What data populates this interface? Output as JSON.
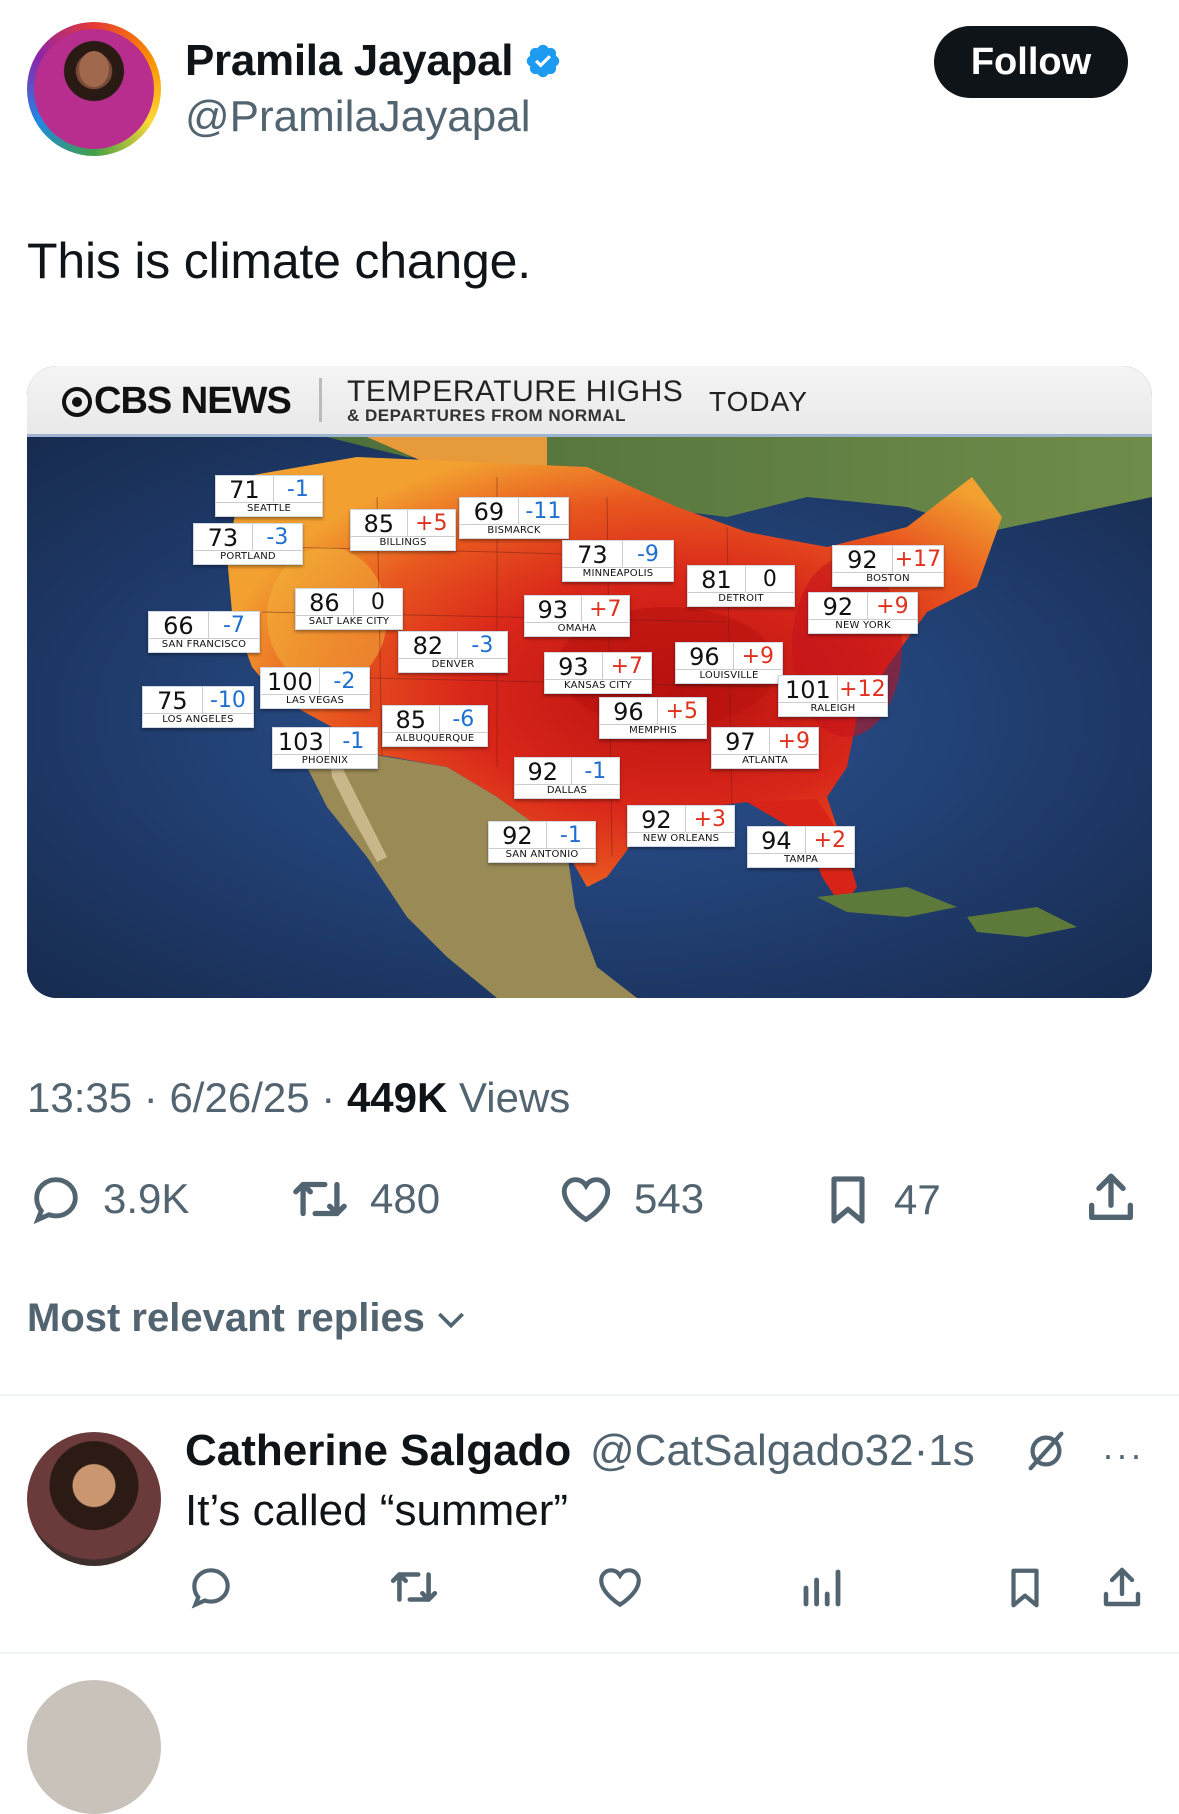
{
  "post": {
    "author_name": "Pramila Jayapal",
    "author_handle": "@PramilaJayapal",
    "follow_label": "Follow",
    "text": "This is climate change.",
    "time": "13:35",
    "date": "6/26/25",
    "dot": "·",
    "views_count": "449K",
    "views_label": "Views",
    "stats": {
      "replies": "3.9K",
      "reposts": "480",
      "likes": "543",
      "bookmarks": "47"
    }
  },
  "media": {
    "brand": "CBS NEWS",
    "title": "TEMPERATURE HIGHS",
    "subtitle": "& DEPARTURES FROM NORMAL",
    "period": "TODAY",
    "cities": [
      {
        "name": "SEATTLE",
        "temp": "71",
        "dep": "-1",
        "sign": "neg"
      },
      {
        "name": "PORTLAND",
        "temp": "73",
        "dep": "-3",
        "sign": "neg"
      },
      {
        "name": "BILLINGS",
        "temp": "85",
        "dep": "+5",
        "sign": "pos"
      },
      {
        "name": "BISMARCK",
        "temp": "69",
        "dep": "-11",
        "sign": "neg"
      },
      {
        "name": "MINNEAPOLIS",
        "temp": "73",
        "dep": "-9",
        "sign": "neg"
      },
      {
        "name": "DETROIT",
        "temp": "81",
        "dep": "0",
        "sign": "zero"
      },
      {
        "name": "BOSTON",
        "temp": "92",
        "dep": "+17",
        "sign": "pos"
      },
      {
        "name": "NEW YORK",
        "temp": "92",
        "dep": "+9",
        "sign": "pos"
      },
      {
        "name": "SALT LAKE CITY",
        "temp": "86",
        "dep": "0",
        "sign": "zero"
      },
      {
        "name": "SAN FRANCISCO",
        "temp": "66",
        "dep": "-7",
        "sign": "neg"
      },
      {
        "name": "OMAHA",
        "temp": "93",
        "dep": "+7",
        "sign": "pos"
      },
      {
        "name": "DENVER",
        "temp": "82",
        "dep": "-3",
        "sign": "neg"
      },
      {
        "name": "KANSAS CITY",
        "temp": "93",
        "dep": "+7",
        "sign": "pos"
      },
      {
        "name": "LOUISVILLE",
        "temp": "96",
        "dep": "+9",
        "sign": "pos"
      },
      {
        "name": "LAS VEGAS",
        "temp": "100",
        "dep": "-2",
        "sign": "neg"
      },
      {
        "name": "LOS ANGELES",
        "temp": "75",
        "dep": "-10",
        "sign": "neg"
      },
      {
        "name": "RALEIGH",
        "temp": "101",
        "dep": "+12",
        "sign": "pos"
      },
      {
        "name": "ALBUQUERQUE",
        "temp": "85",
        "dep": "-6",
        "sign": "neg"
      },
      {
        "name": "MEMPHIS",
        "temp": "96",
        "dep": "+5",
        "sign": "pos"
      },
      {
        "name": "PHOENIX",
        "temp": "103",
        "dep": "-1",
        "sign": "neg"
      },
      {
        "name": "ATLANTA",
        "temp": "97",
        "dep": "+9",
        "sign": "pos"
      },
      {
        "name": "DALLAS",
        "temp": "92",
        "dep": "-1",
        "sign": "neg"
      },
      {
        "name": "NEW ORLEANS",
        "temp": "92",
        "dep": "+3",
        "sign": "pos"
      },
      {
        "name": "SAN ANTONIO",
        "temp": "92",
        "dep": "-1",
        "sign": "neg"
      },
      {
        "name": "TAMPA",
        "temp": "94",
        "dep": "+2",
        "sign": "pos"
      }
    ]
  },
  "replies_sort_label": "Most relevant replies",
  "reply": {
    "author_name": "Catherine Salgado",
    "author_handle": "@CatSalgado32",
    "time": "1s",
    "dot": "·",
    "text": "It’s called “summer”",
    "more": "···"
  },
  "colors": {
    "text_primary": "#0f1419",
    "text_secondary": "#536471",
    "verified_blue": "#1d9bf0",
    "dep_positive": "#e0301e",
    "dep_negative": "#1f6fd1"
  },
  "icons": [
    "verified-badge-icon",
    "reply-icon",
    "repost-icon",
    "like-icon",
    "bookmark-icon",
    "share-icon",
    "chevron-down-icon",
    "grok-icon",
    "more-icon",
    "analytics-icon"
  ]
}
